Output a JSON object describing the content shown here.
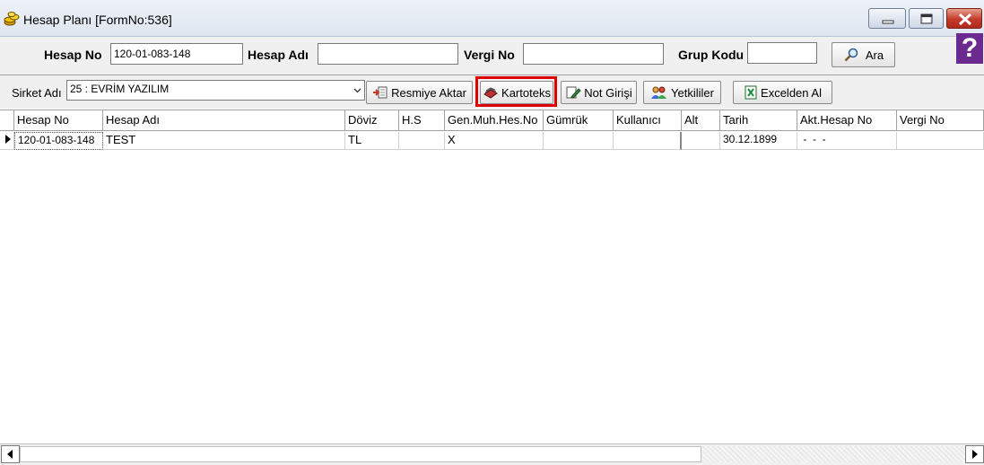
{
  "window": {
    "title": "Hesap Planı [FormNo:536]",
    "icon": "coins-icon",
    "buttons": [
      "minimize-icon",
      "maximize-icon",
      "close-icon"
    ]
  },
  "search": {
    "hesap_no_label": "Hesap No",
    "hesap_no_value": "120-01-083-148",
    "hesap_adi_label": "Hesap Adı",
    "hesap_adi_value": "",
    "vergi_no_label": "Vergi No",
    "vergi_no_value": "",
    "grup_kodu_label": "Grup Kodu",
    "grup_kodu_value": "",
    "ara_label": "Ara",
    "help_label": "?"
  },
  "toolbar": {
    "sirket_label": "Sirket Adı",
    "sirket_value": "25 : EVRİM YAZILIM",
    "resmiye_aktar": "Resmiye Aktar",
    "kartoteks": "Kartoteks",
    "not_girisi": "Not Girişi",
    "yetkililer": "Yetkililer",
    "excelden_al": "Excelden Al",
    "highlight_color": "#e00000"
  },
  "grid": {
    "columns": [
      "Hesap No",
      "Hesap Adı",
      "Döviz",
      "H.S",
      "Gen.Muh.Hes.No",
      "Gümrük",
      "Kullanıcı",
      "Alt",
      "Tarih",
      "Akt.Hesap No",
      "Vergi No"
    ],
    "rows": [
      [
        "120-01-083-148",
        "TEST",
        "TL",
        "",
        "X",
        "",
        "",
        "",
        "30.12.1899",
        " -  -  -",
        ""
      ]
    ]
  }
}
